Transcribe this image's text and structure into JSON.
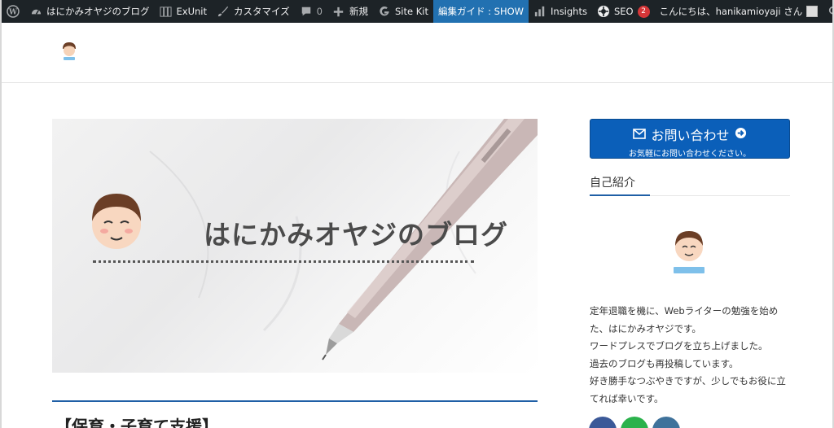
{
  "adminbar": {
    "site_name": "はにかみオヤジのブログ",
    "exunit": "ExUnit",
    "customize": "カスタマイズ",
    "comments_count": "0",
    "new": "新規",
    "site_kit": "Site Kit",
    "edit_guide": "編集ガイド : SHOW",
    "insights": "Insights",
    "seo": "SEO",
    "seo_badge": "2",
    "greeting": "こんにちは、hanikamioyaji さん"
  },
  "hero": {
    "title": "はにかみオヤジのブログ"
  },
  "article": {
    "title": "【保育・子育て支援】"
  },
  "sidebar": {
    "contact_label": "お問い合わせ",
    "contact_sub": "お気軽にお問い合わせください。",
    "profile_heading": "自己紹介",
    "profile_lines": [
      "定年退職を機に、Webライターの勉強を始め",
      "た、はにかみオヤジです。",
      "ワードプレスでブログを立ち上げました。",
      "過去のブログも再投稿しています。",
      "好き勝手なつぶやきですが、少しでもお役に立",
      "てれば幸いです。"
    ]
  },
  "colors": {
    "adminbar": "#1d2327",
    "accent": "#2271b1",
    "contact_button": "#0b5fb9",
    "facebook": "#3b5998",
    "feedly": "#2bb24c",
    "instagram": "#3f729b"
  }
}
